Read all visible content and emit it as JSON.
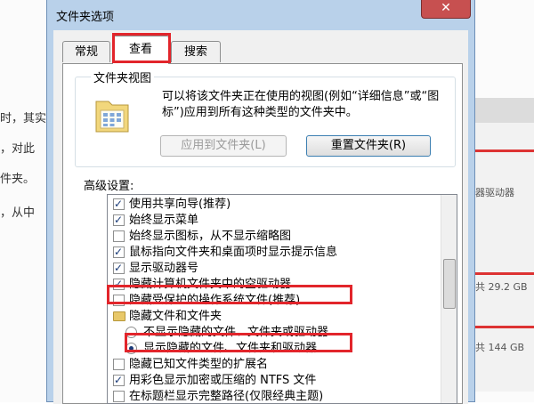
{
  "background": {
    "lines": [
      "时，其实",
      "，对此",
      "件夹。",
      "，从中"
    ],
    "right_texts": [
      "器驱动器",
      "共 29.2 GB",
      "共 144 GB"
    ]
  },
  "dialog": {
    "title": "文件夹选项",
    "close_glyph": "✕",
    "tabs": [
      "常规",
      "查看",
      "搜索"
    ],
    "folder_view": {
      "title": "文件夹视图",
      "description": "可以将该文件夹正在使用的视图(例如“详细信息”或“图标”)应用到所有这种类型的文件夹中。",
      "apply_button": "应用到文件夹(L)",
      "reset_button": "重置文件夹(R)"
    },
    "advanced": {
      "title": "高级设置:",
      "items": [
        {
          "type": "checkbox",
          "checked": true,
          "label": "使用共享向导(推荐)"
        },
        {
          "type": "checkbox",
          "checked": true,
          "label": "始终显示菜单"
        },
        {
          "type": "checkbox",
          "checked": false,
          "label": "始终显示图标，从不显示缩略图"
        },
        {
          "type": "checkbox",
          "checked": true,
          "label": "鼠标指向文件夹和桌面项时显示提示信息"
        },
        {
          "type": "checkbox",
          "checked": true,
          "label": "显示驱动器号"
        },
        {
          "type": "checkbox",
          "checked": true,
          "label": "隐藏计算机文件夹中的空驱动器"
        },
        {
          "type": "checkbox",
          "checked": false,
          "label": "隐藏受保护的操作系统文件(推荐)"
        },
        {
          "type": "folder",
          "label": "隐藏文件和文件夹"
        },
        {
          "type": "radio",
          "checked": false,
          "label": "不显示隐藏的文件、文件夹或驱动器"
        },
        {
          "type": "radio",
          "checked": true,
          "label": "显示隐藏的文件、文件夹和驱动器"
        },
        {
          "type": "checkbox",
          "checked": false,
          "label": "隐藏已知文件类型的扩展名"
        },
        {
          "type": "checkbox",
          "checked": true,
          "label": "用彩色显示加密或压缩的 NTFS 文件"
        },
        {
          "type": "checkbox",
          "checked": false,
          "label": "在标题栏显示完整路径(仅限经典主题)"
        }
      ]
    }
  },
  "colors": {
    "highlight": "#e2252b",
    "close_button": "#c75050",
    "frame": "#b9d1ea"
  }
}
